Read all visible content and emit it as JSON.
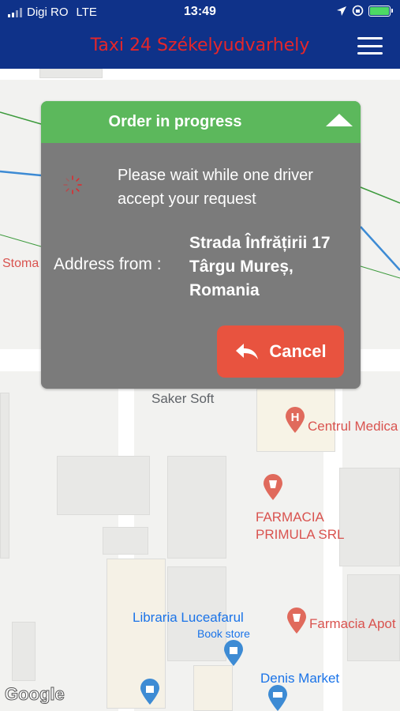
{
  "status_bar": {
    "carrier": "Digi RO",
    "network": "LTE",
    "time": "13:49",
    "battery_icon": "battery-charging-icon",
    "location_icon": "location-arrow-icon",
    "lock_icon": "orientation-lock-icon"
  },
  "header": {
    "title": "Taxi 24 Székelyudvarhely",
    "menu_icon": "hamburger-menu-icon",
    "background_color": "#0f3289",
    "title_color": "#e5262a"
  },
  "dialog": {
    "title": "Order in progress",
    "title_bg_color": "#5cb85c",
    "wait_message": "Please wait while one driver accept your request",
    "address_label": "Address from  :",
    "address_value": "Strada Înfrățirii 17 Târgu Mureș, Romania",
    "cancel_label": "Cancel",
    "cancel_color": "#e8533f"
  },
  "map": {
    "labels": {
      "stoma": "Stoma",
      "saker_soft": "Saker Soft",
      "centrul_medical": "Centrul Medica",
      "farmacia_primula_1": "FARMACIA",
      "farmacia_primula_2": "PRIMULA SRL",
      "libraria": "Libraria Luceafarul",
      "book_store": "Book store",
      "farmacia_apot": "Farmacia Apot",
      "denis_market": "Denis Market",
      "google": "Google"
    }
  }
}
